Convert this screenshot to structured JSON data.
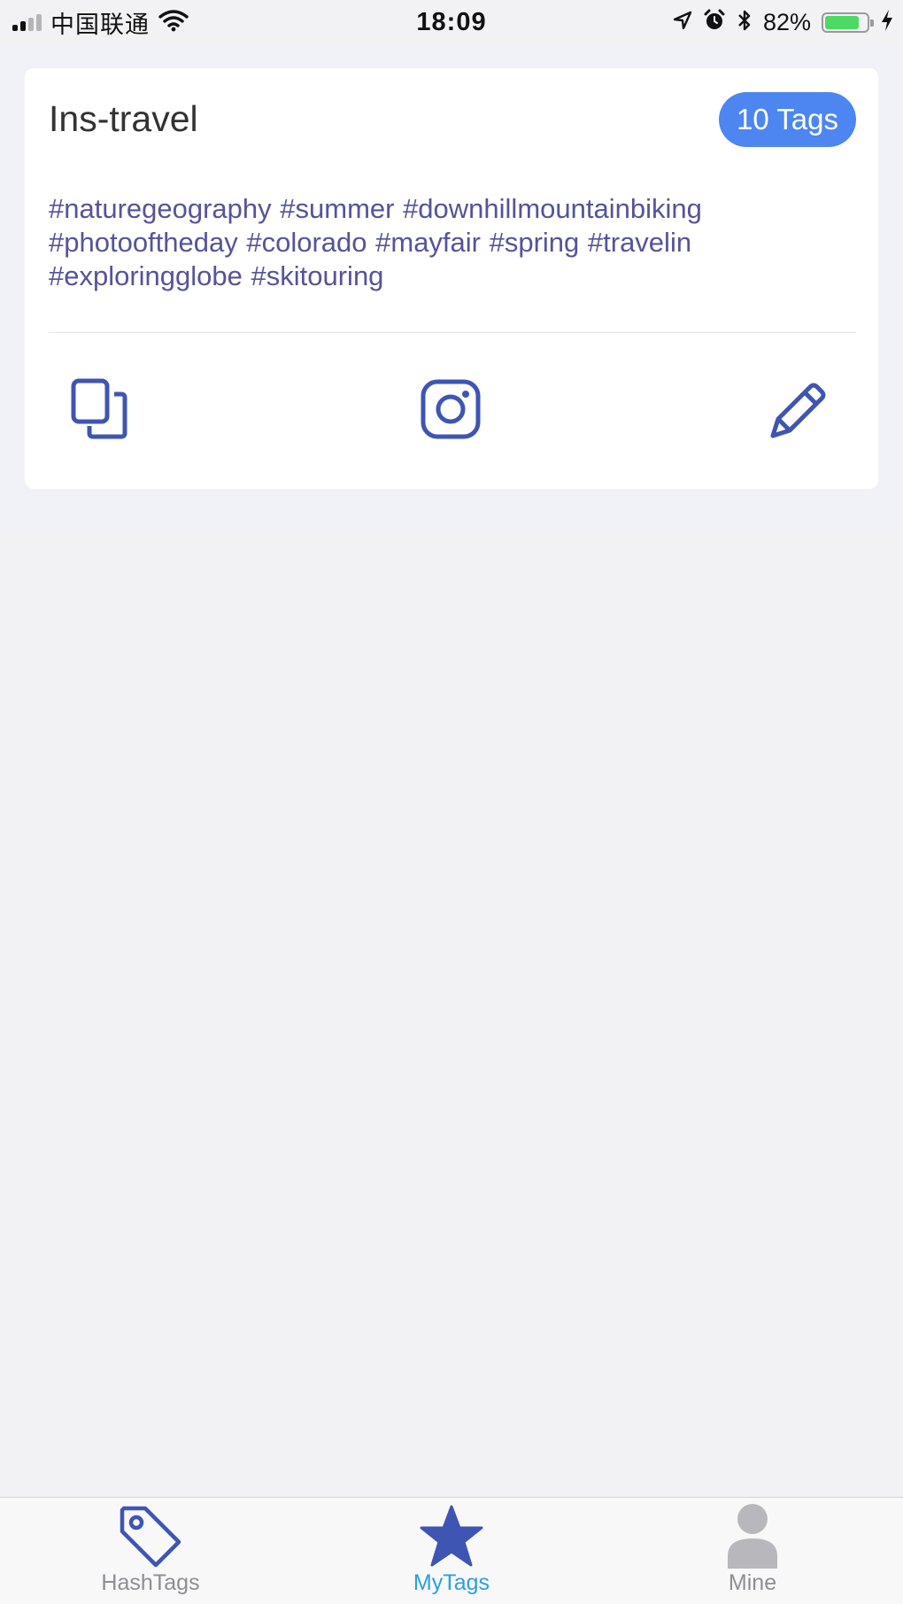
{
  "status_bar": {
    "carrier": "中国联通",
    "time": "18:09",
    "battery_percent": "82%",
    "battery_level": 0.82,
    "icons": [
      "signal-icon",
      "wifi-icon",
      "location-icon",
      "alarm-icon",
      "bluetooth-icon",
      "battery-icon",
      "charging-icon"
    ]
  },
  "card": {
    "title": "Ins-travel",
    "tag_count_label": "10 Tags",
    "hashtags_text": "#naturegeography #summer #downhillmountainbiking #photooftheday #colorado #mayfair #spring #travelin #exploringglobe #skitouring",
    "actions": [
      {
        "name": "copy-button",
        "icon": "copy-icon"
      },
      {
        "name": "instagram-button",
        "icon": "instagram-icon"
      },
      {
        "name": "edit-button",
        "icon": "pencil-icon"
      }
    ]
  },
  "tab_bar": {
    "tabs": [
      {
        "label": "HashTags",
        "icon": "tag-icon",
        "active": false
      },
      {
        "label": "MyTags",
        "icon": "star-icon",
        "active": true
      },
      {
        "label": "Mine",
        "icon": "person-icon",
        "active": false
      }
    ]
  },
  "colors": {
    "accent_blue": "#4d86f1",
    "icon_blue": "#3f55b4",
    "hashtag_text": "#55539a",
    "active_tab": "#2d9fe0",
    "inactive_tab": "#8e8e93",
    "battery_green": "#4cd964"
  }
}
